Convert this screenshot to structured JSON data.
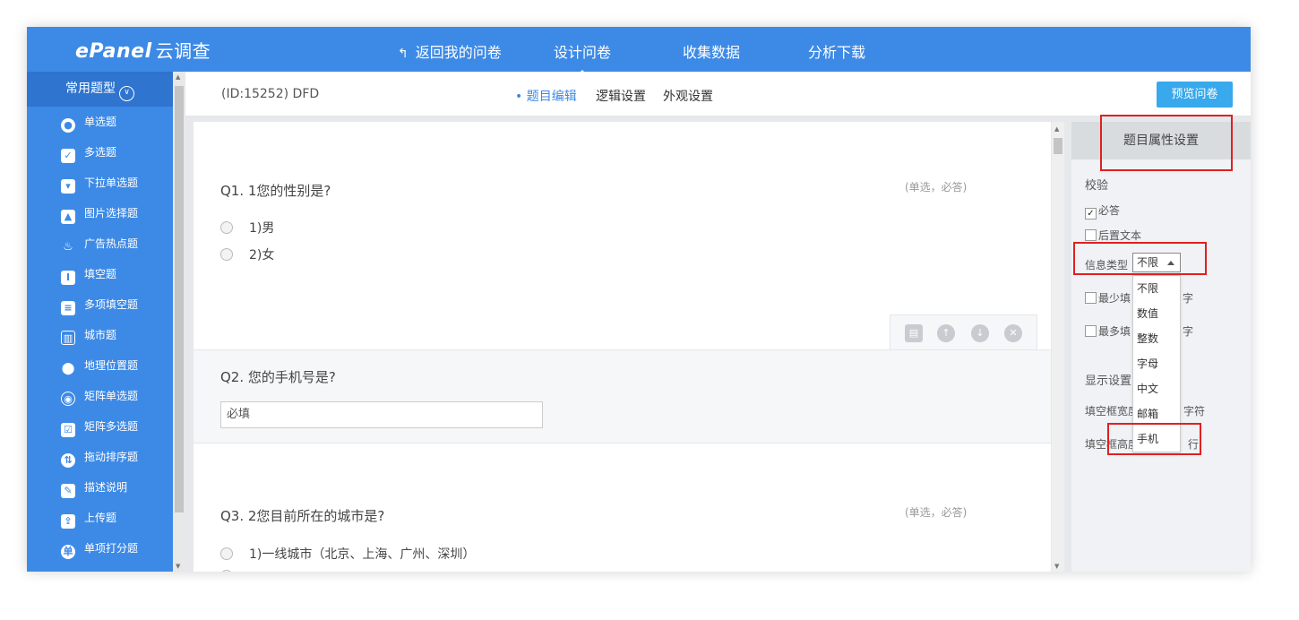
{
  "app": {
    "logo_main": "ePanel",
    "logo_sub": "云调查"
  },
  "topnav": {
    "back_label": "返回我的问卷",
    "design_label": "设计问卷",
    "collect_label": "收集数据",
    "analyze_label": "分析下载"
  },
  "sidebar": {
    "header": "常用题型",
    "items": [
      {
        "label": "单选题",
        "icon": "radio-icon"
      },
      {
        "label": "多选题",
        "icon": "checkbox-icon"
      },
      {
        "label": "下拉单选题",
        "icon": "dropdown-icon"
      },
      {
        "label": "图片选择题",
        "icon": "image-icon"
      },
      {
        "label": "广告热点题",
        "icon": "flame-icon"
      },
      {
        "label": "填空题",
        "icon": "text-cursor-icon"
      },
      {
        "label": "多项填空题",
        "icon": "multi-fill-icon"
      },
      {
        "label": "城市题",
        "icon": "building-icon"
      },
      {
        "label": "地理位置题",
        "icon": "location-pin-icon"
      },
      {
        "label": "矩阵单选题",
        "icon": "target-icon"
      },
      {
        "label": "矩阵多选题",
        "icon": "matrix-check-icon"
      },
      {
        "label": "拖动排序题",
        "icon": "sort-icon"
      },
      {
        "label": "描述说明",
        "icon": "pencil-icon"
      },
      {
        "label": "上传题",
        "icon": "upload-image-icon"
      },
      {
        "label": "单项打分题",
        "icon": "score-icon"
      }
    ]
  },
  "header": {
    "survey_id": "(ID:15252)  DFD",
    "tabs": [
      "题目编辑",
      "逻辑设置",
      "外观设置"
    ],
    "preview_label": "预览问卷"
  },
  "questions": {
    "q1": {
      "title": "Q1.  1您的性别是?",
      "tag": "(单选，必答)",
      "options": [
        "1)男",
        "2)女"
      ]
    },
    "q2": {
      "title": "Q2.  您的手机号是?",
      "placeholder": "必填"
    },
    "q3": {
      "title": "Q3.  2您目前所在的城市是?",
      "tag": "(单选，必答)",
      "options": [
        "1)一线城市（北京、上海、广州、深圳）"
      ]
    }
  },
  "panel": {
    "title": "题目属性设置",
    "validation_label": "校验",
    "required_label": "必答",
    "required_checked": true,
    "suffix_label": "后置文本",
    "info_type_label": "信息类型",
    "info_type_value": "不限",
    "min_label": "最少填",
    "min_suffix": "字",
    "max_label": "最多填",
    "max_suffix": "字",
    "display_label": "显示设置",
    "width_label": "填空框宽度",
    "width_suffix": "字符",
    "height_label": "填空框高度",
    "height_suffix": "行",
    "dropdown_options": [
      "不限",
      "数值",
      "整数",
      "字母",
      "中文",
      "邮箱",
      "手机"
    ]
  },
  "colors": {
    "brand": "#3d8ae6",
    "preview": "#37a9ec",
    "highlight": "#e02020"
  }
}
